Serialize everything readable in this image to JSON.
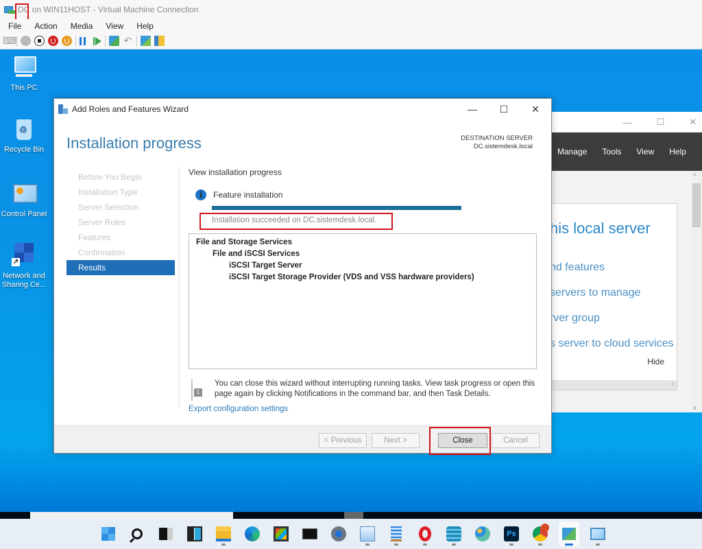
{
  "vm_window": {
    "title": "DC on WIN11HOST - Virtual Machine Connection",
    "menu": [
      "File",
      "Action",
      "Media",
      "View",
      "Help"
    ],
    "toolbar_icons": [
      "ctrl-alt-del-icon",
      "start-icon",
      "turn-off-icon",
      "shut-down-icon",
      "save-icon",
      "pause-icon",
      "reset-icon",
      "checkpoint-icon",
      "revert-icon",
      "enhanced-session-icon",
      "share-icon"
    ]
  },
  "desktop": {
    "icons": [
      {
        "label": "This PC",
        "icon": "this-pc-icon"
      },
      {
        "label": "Recycle Bin",
        "icon": "recycle-bin-icon"
      },
      {
        "label": "Control Panel",
        "icon": "control-panel-icon"
      },
      {
        "label": "Network and Sharing Ce...",
        "icon": "network-sharing-icon"
      }
    ]
  },
  "server_manager": {
    "menu": [
      "Manage",
      "Tools",
      "View",
      "Help"
    ],
    "panel_heading": "his local server",
    "links": [
      "nd features",
      "servers to manage",
      "rver group",
      "s server to cloud services"
    ],
    "hide_label": "Hide"
  },
  "wizard": {
    "title": "Add Roles and Features Wizard",
    "page_title": "Installation progress",
    "destination_label": "DESTINATION SERVER",
    "destination_server": "DC.sistemdesk.local",
    "nav": [
      {
        "label": "Before You Begin",
        "active": false
      },
      {
        "label": "Installation Type",
        "active": false
      },
      {
        "label": "Server Selection",
        "active": false
      },
      {
        "label": "Server Roles",
        "active": false
      },
      {
        "label": "Features",
        "active": false
      },
      {
        "label": "Confirmation",
        "active": false
      },
      {
        "label": "Results",
        "active": true
      }
    ],
    "subtitle": "View installation progress",
    "feature_label": "Feature installation",
    "progress_percent": 100,
    "status": "Installation succeeded on DC.sistemdesk.local.",
    "results": [
      {
        "text": "File and Storage Services",
        "level": 0
      },
      {
        "text": "File and iSCSI Services",
        "level": 1
      },
      {
        "text": "iSCSI Target Server",
        "level": 2
      },
      {
        "text": "iSCSI Target Storage Provider (VDS and VSS hardware providers)",
        "level": 2
      }
    ],
    "note": "You can close this wizard without interrupting running tasks. View task progress or open this page again by clicking Notifications in the command bar, and then Task Details.",
    "export_link": "Export configuration settings",
    "buttons": {
      "previous": "< Previous",
      "next": "Next >",
      "close": "Close",
      "cancel": "Cancel"
    }
  },
  "taskbar": {
    "items": [
      {
        "name": "start-button",
        "active": false
      },
      {
        "name": "search-button",
        "active": false
      },
      {
        "name": "task-view-button",
        "active": false
      },
      {
        "name": "widgets-button",
        "active": false
      },
      {
        "name": "file-explorer-button",
        "active": false
      },
      {
        "name": "edge-button",
        "active": false
      },
      {
        "name": "store-button",
        "active": false
      },
      {
        "name": "terminal-button",
        "active": false
      },
      {
        "name": "settings-button",
        "active": false
      },
      {
        "name": "performance-monitor-button",
        "active": false
      },
      {
        "name": "notepad-button",
        "active": false
      },
      {
        "name": "opera-button",
        "active": false
      },
      {
        "name": "database-app-button",
        "active": false
      },
      {
        "name": "paint-button",
        "active": false
      },
      {
        "name": "photoshop-button",
        "active": false
      },
      {
        "name": "chrome-button",
        "active": false
      },
      {
        "name": "vm-connection-button",
        "active": true
      },
      {
        "name": "control-panel-button",
        "active": false
      }
    ]
  },
  "colors": {
    "accent": "#1e6fb8",
    "progress": "#1c6f99",
    "highlight": "#d0141b",
    "title_text": "#3a7dae"
  }
}
